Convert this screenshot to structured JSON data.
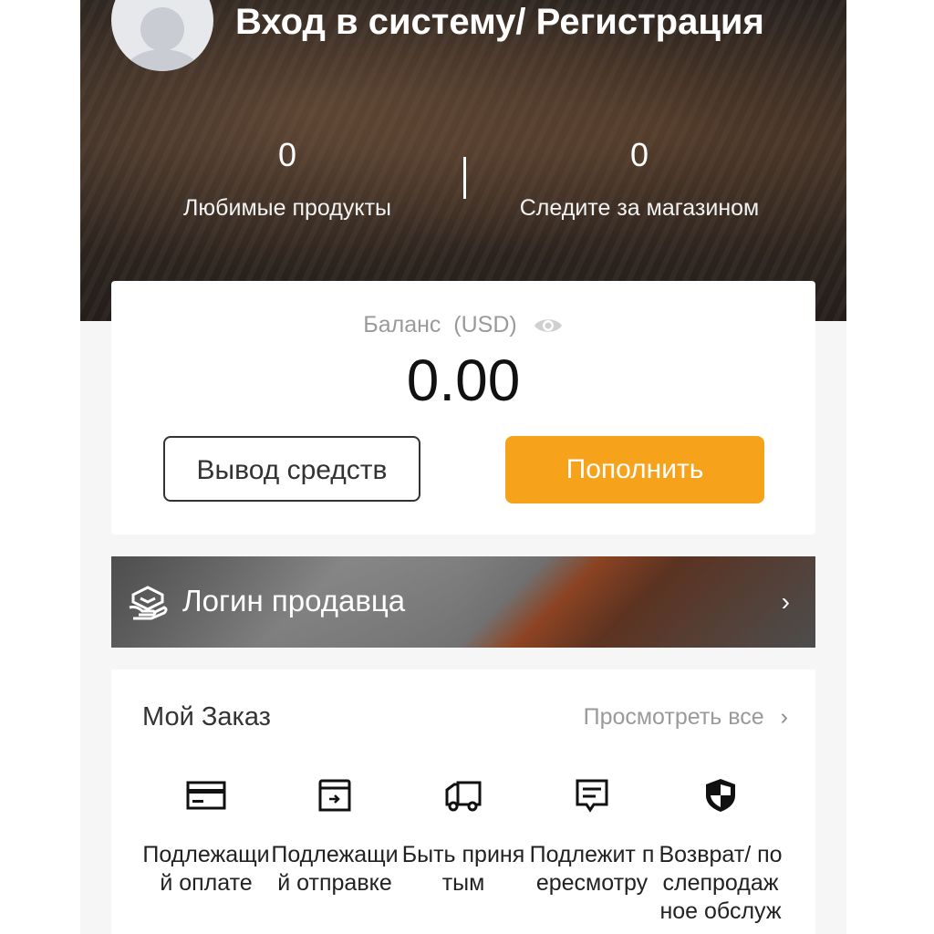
{
  "header": {
    "login_title": "Вход в систему/ Регистрация",
    "favorites": {
      "count": "0",
      "label": "Любимые продукты"
    },
    "following": {
      "count": "0",
      "label": "Следите за магазином"
    }
  },
  "balance": {
    "label": "Баланс  (USD)",
    "value": "0.00",
    "withdraw_label": "Вывод средств",
    "topup_label": "Пополнить",
    "accent_color": "#f7a21b"
  },
  "seller": {
    "label": "Логин продавца",
    "icon": "handshake-icon"
  },
  "orders": {
    "title": "Мой Заказ",
    "view_all": "Просмотреть все",
    "items": [
      {
        "label": "Подлежащий оплате",
        "icon": "card-icon"
      },
      {
        "label": "Подлежащий отправке",
        "icon": "box-icon"
      },
      {
        "label": "Быть принятым",
        "icon": "truck-icon"
      },
      {
        "label": "Подлежит пересмотру",
        "icon": "review-icon"
      },
      {
        "label": "Возврат/ послепродажное обслуживание",
        "icon": "shield-icon"
      }
    ]
  }
}
